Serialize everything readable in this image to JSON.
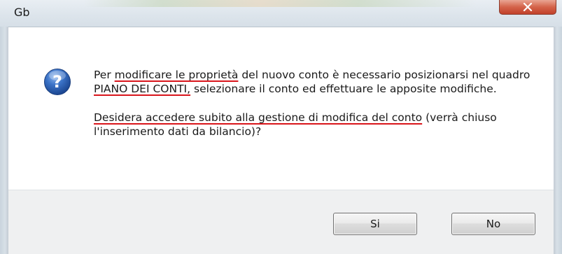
{
  "window": {
    "title": "Gb",
    "close_icon": "close-icon"
  },
  "message": {
    "icon": "question-icon",
    "p1_underlined_1": "modificare le proprietà",
    "p1_part_1": "Per ",
    "p1_part_2": " del nuovo conto è necessario posizionarsi nel quadro ",
    "p1_underlined_2": "PIANO DEI CONTI,",
    "p1_part_3": " selezionare il conto ed effettuare le apposite modifiche.",
    "p2_underlined": "Desidera accedere subito alla gestione di modifica del conto",
    "p2_rest": " (verrà chiuso l'inserimento dati da bilancio)?"
  },
  "buttons": {
    "yes_label": "Si",
    "no_label": "No"
  },
  "colors": {
    "underline": "#d9151b",
    "icon_blue": "#2a5fb0",
    "close_red": "#c1412a"
  }
}
